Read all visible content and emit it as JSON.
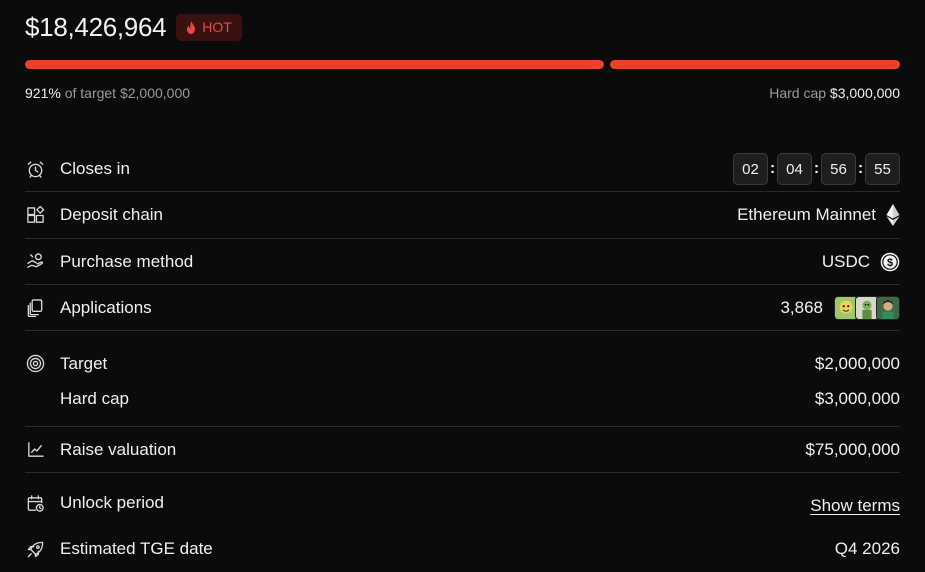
{
  "header": {
    "amount": "$18,426,964",
    "badge_label": "HOT",
    "progress_percent": 921,
    "progress_text": "921%",
    "target_prefix": "of target",
    "target_value": "$2,000,000",
    "hardcap_prefix": "Hard cap",
    "hardcap_value": "$3,000,000"
  },
  "rows": {
    "closes_in": {
      "label": "Closes in",
      "timer": [
        "02",
        "04",
        "56",
        "55"
      ]
    },
    "deposit_chain": {
      "label": "Deposit chain",
      "value": "Ethereum Mainnet",
      "icon": "ethereum-icon"
    },
    "purchase_method": {
      "label": "Purchase method",
      "value": "USDC",
      "icon": "usdc-icon"
    },
    "applications": {
      "label": "Applications",
      "value": "3,868"
    },
    "target": {
      "label": "Target",
      "value": "$2,000,000"
    },
    "hard_cap": {
      "label": "Hard cap",
      "value": "$3,000,000"
    },
    "raise_valuation": {
      "label": "Raise valuation",
      "value": "$75,000,000"
    },
    "unlock_period": {
      "label": "Unlock period",
      "link": "Show terms"
    },
    "tge_date": {
      "label": "Estimated TGE date",
      "value": "Q4 2026"
    }
  },
  "colors": {
    "progress": "#e8412c",
    "badge_bg": "#3a1111",
    "badge_text": "#e5484d",
    "background": "#0b0b0b"
  }
}
